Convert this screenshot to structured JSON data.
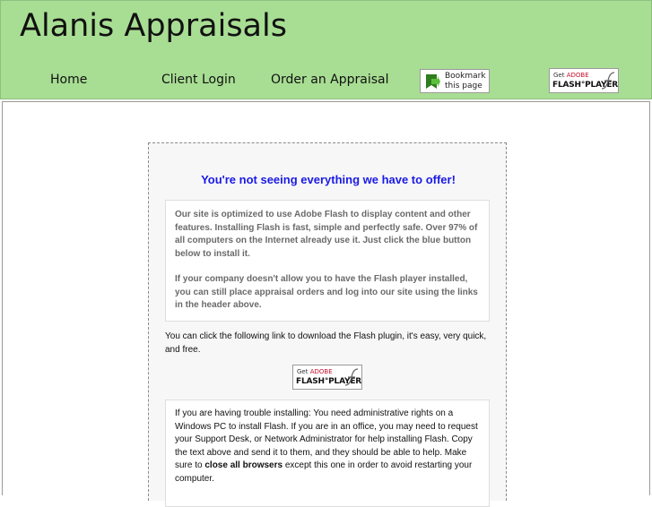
{
  "header": {
    "site_title": "Alanis Appraisals",
    "nav": {
      "home": "Home",
      "client_login": "Client Login",
      "order_appraisal": "Order an Appraisal"
    },
    "bookmark": {
      "line1": "Bookmark",
      "line2": "this page"
    },
    "flash_badge": {
      "get": "Get",
      "adobe": "ADOBE",
      "player": "FLASH°PLAYER"
    }
  },
  "notice": {
    "heading": "You're not seeing everything we have to offer!",
    "info_paragraph_1": "Our site is optimized to use Adobe Flash to display content and other features. Installing Flash is fast, simple and perfectly safe. Over 97% of all computers on the Internet already use it. Just click the blue button below to install it.",
    "info_paragraph_2": "If your company doesn't allow you to have the Flash player installed, you can still place appraisal orders and log into our site using the links in the header above.",
    "download_text": "You can click the following link to download the Flash plugin, it's easy, very quick, and free.",
    "trouble_text_before": "If you are having trouble installing: You need administrative rights on a Windows PC to install Flash. If you are in an office, you may need to request your Support Desk, or Network Administrator for help installing Flash. Copy the text above and send it to them, and they should be able to help. Make sure to ",
    "trouble_text_bold": "close all browsers",
    "trouble_text_after": " except this one in order to avoid restarting your computer."
  },
  "colors": {
    "header_bg": "#a8de93",
    "heading_blue": "#1a1ae6",
    "adobe_red": "#c8102e"
  },
  "icons": [
    "bookmark-arrow-icon",
    "flash-f-icon"
  ]
}
